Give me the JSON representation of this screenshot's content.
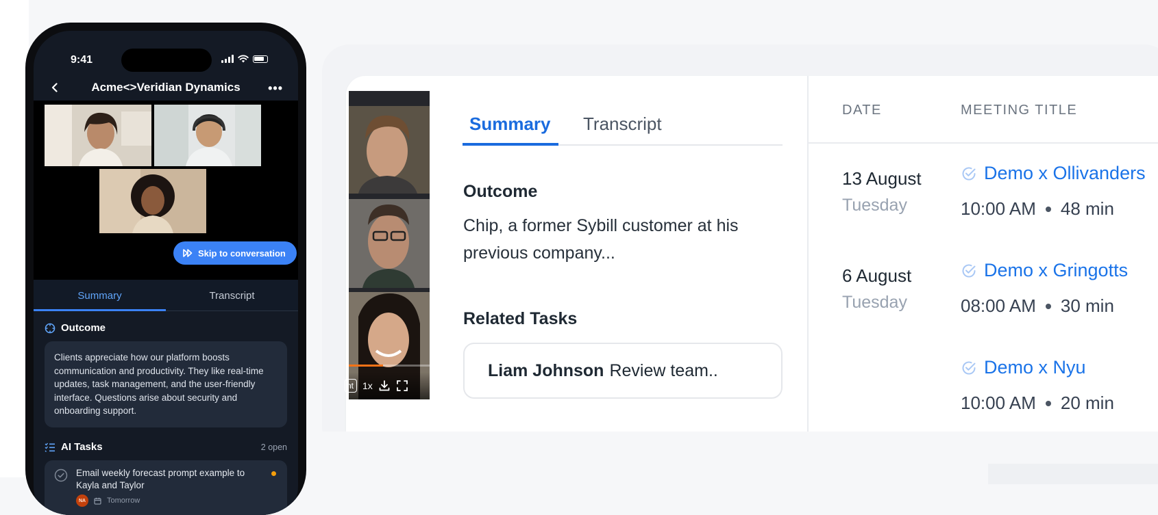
{
  "phone": {
    "status_time": "9:41",
    "nav_title": "Acme<>Veridian Dynamics",
    "more_label": "•••",
    "skip_label": "Skip to conversation",
    "tabs": {
      "summary": "Summary",
      "transcript": "Transcript"
    },
    "outcome_title": "Outcome",
    "outcome_text": "Clients appreciate how our platform boosts communication and productivity. They like real-time updates, task management, and the user-friendly interface. Questions arise about security and onboarding support.",
    "tasks_title": "AI Tasks",
    "tasks_count": "2 open",
    "task": {
      "text": "Email weekly forecast prompt example to Kayla and Taylor",
      "avatar": "NA",
      "due": "Tomorrow"
    }
  },
  "player": {
    "mode_label": "nt",
    "speed_label": "1x",
    "progress": 0.42,
    "accent_color": "#f97316"
  },
  "detail": {
    "tabs": {
      "summary": "Summary",
      "transcript": "Transcript"
    },
    "outcome_title": "Outcome",
    "outcome_text": "Chip, a former Sybill customer at his previous company...",
    "related_title": "Related Tasks",
    "related_task": {
      "name": "Liam Johnson",
      "text": "Review team.."
    }
  },
  "meetings": {
    "headers": {
      "date": "DATE",
      "title": "MEETING TITLE"
    },
    "rows": [
      {
        "date": "13 August",
        "day": "Tuesday",
        "title": "Demo x Ollivanders",
        "time": "10:00 AM",
        "duration": "48 min"
      },
      {
        "date": "6 August",
        "day": "Tuesday",
        "title": "Demo x Gringotts",
        "time": "08:00 AM",
        "duration": "30 min"
      },
      {
        "date": "",
        "day": "",
        "title": "Demo x Nyu",
        "time": "10:00 AM",
        "duration": "20 min"
      }
    ]
  },
  "colors": {
    "accent": "#1a73e8",
    "phone_accent": "#3b82f6",
    "task_dot": "#f59e0b"
  },
  "icons": [
    "back-chevron-icon",
    "more-icon",
    "skip-icon",
    "outcome-icon",
    "tasks-list-icon",
    "check-circle-icon",
    "calendar-icon",
    "download-icon",
    "fullscreen-icon",
    "signal-icon",
    "wifi-icon",
    "battery-icon"
  ]
}
